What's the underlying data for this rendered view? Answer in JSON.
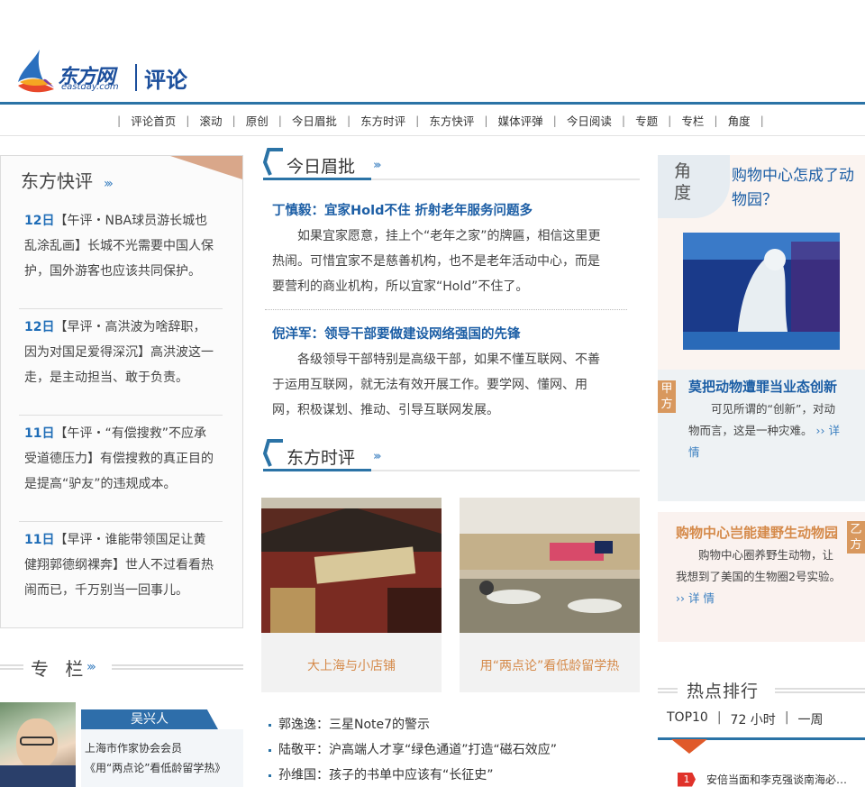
{
  "header": {
    "logo_cn": "东方网",
    "logo_en": "eastday.com",
    "logo_sub": "评论",
    "nav": [
      "评论首页",
      "滚动",
      "原创",
      "今日眉批",
      "东方时评",
      "东方快评",
      "媒体评弹",
      "今日阅读",
      "专题",
      "专栏",
      "角度"
    ]
  },
  "quick": {
    "title": "东方快评",
    "items": [
      {
        "date": "12日",
        "text": "【午评・NBA球员游长城也乱涂乱画】长城不光需要中国人保护，国外游客也应该共同保护。"
      },
      {
        "date": "12日",
        "text": "【早评・高洪波为啥辞职，因为对国足爱得深沉】高洪波这一走，是主动担当、敢于负责。"
      },
      {
        "date": "11日",
        "text": "【午评・“有偿搜救”不应承受道德压力】有偿搜救的真正目的是提高“驴友”的违规成本。"
      },
      {
        "date": "11日",
        "text": "【早评・谁能带领国足让黄健翔郭德纲裸奔】世人不过看看热闹而已，千万别当一回事儿。"
      }
    ]
  },
  "column": {
    "title": "专 栏",
    "name": "吴兴人",
    "role": "上海市作家协会会员",
    "article": "《用“两点论”看低龄留学热》"
  },
  "today": {
    "title": "今日眉批",
    "articles": [
      {
        "title": "丁慎毅：宜家Hold不住 折射老年服务问题多",
        "body": "如果宜家愿意，挂上个“老年之家”的牌匾，相信这里更热闹。可惜宜家不是慈善机构，也不是老年活动中心，而是要营利的商业机构，所以宜家“Hold”不住了。"
      },
      {
        "title": "倪洋军：领导干部要做建设网络强国的先锋",
        "body": "各级领导干部特别是高级干部，如果不懂互联网、不善于运用互联网，就无法有效开展工作。要学网、懂网、用网，积极谋划、推动、引导互联网发展。"
      }
    ]
  },
  "east": {
    "title": "东方时评",
    "cards": [
      {
        "caption": "大上海与小店铺"
      },
      {
        "caption": "用“两点论”看低龄留学热"
      }
    ],
    "list": [
      "郭逸逸：三星Note7的警示",
      "陆敬平：沪高端人才享“绿色通道”打造“磁石效应”",
      "孙维国：孩子的书单中应该有“长征史”"
    ]
  },
  "angle": {
    "tab": "角度",
    "question": "购物中心怎成了动物园？",
    "side_a": {
      "badge": "甲方",
      "title": "莫把动物遭罪当业态创新",
      "text": "可见所谓的“创新”，对动物而言，这是一种灾难。",
      "more": "详情"
    },
    "side_b": {
      "badge": "乙方",
      "title": "购物中心岂能建野生动物园",
      "text": "购物中心圈养野生动物，让我想到了美国的生物圈2号实验。",
      "more": "详 情"
    }
  },
  "hot": {
    "title": "热点排行",
    "tabs": [
      "TOP10",
      "72 小时",
      "一周"
    ],
    "rank1": {
      "num": "1",
      "text": "安倍当面和李克强谈南海必…"
    }
  },
  "colors": {
    "accent": "#2b73a6",
    "link": "#1c5ea5",
    "orange": "#d58a4a"
  }
}
